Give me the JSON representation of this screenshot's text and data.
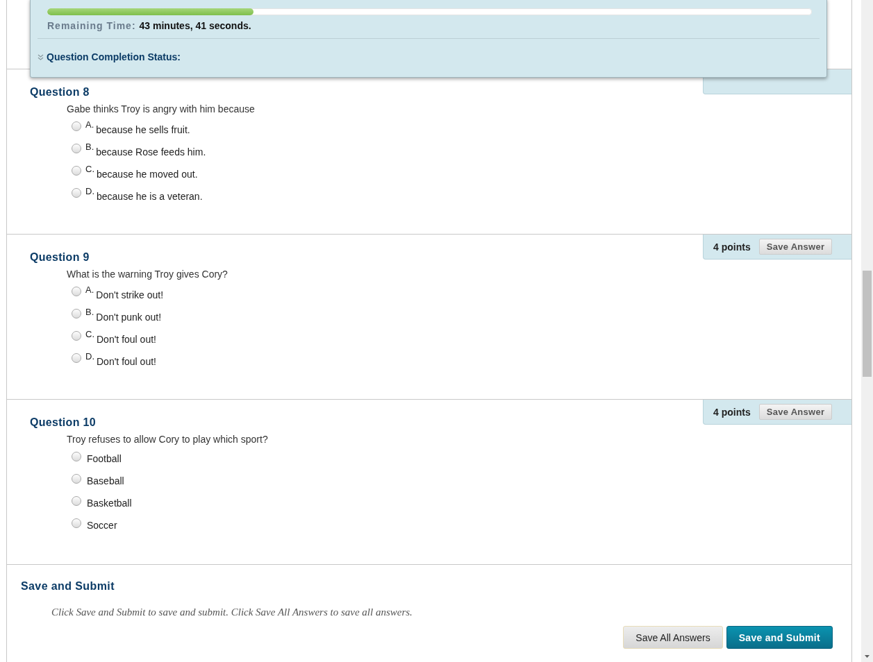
{
  "timer": {
    "level": 0.27,
    "label": "Remaining Time:",
    "value": "43 minutes, 41 seconds."
  },
  "completion_status": {
    "label": "Question Completion Status:",
    "expanded": false
  },
  "questions": [
    {
      "title": "Question 8",
      "prompt": "Gabe thinks Troy is angry with him because",
      "options": [
        {
          "letter": "A.",
          "text": "because he sells fruit.",
          "selected": false
        },
        {
          "letter": "B.",
          "text": "because Rose feeds him.",
          "selected": false
        },
        {
          "letter": "C.",
          "text": "because he moved out.",
          "selected": false
        },
        {
          "letter": "D.",
          "text": "because he is a veteran.",
          "selected": false
        }
      ]
    },
    {
      "title": "Question 9",
      "points": "4 points",
      "action": "Save Answer",
      "prompt": "What is the warning Troy gives Cory?",
      "options": [
        {
          "letter": "A.",
          "text": "Don't strike out!",
          "selected": false
        },
        {
          "letter": "B.",
          "text": "Don't punk out!",
          "selected": false
        },
        {
          "letter": "C.",
          "text": "Don't foul out!",
          "selected": false
        },
        {
          "letter": "D.",
          "text": "Don't foul out!",
          "selected": false
        }
      ]
    },
    {
      "title": "Question 10",
      "points": "4 points",
      "action": "Save Answer",
      "prompt": "Troy refuses to allow Cory to play which sport?",
      "options": [
        {
          "text": "Football",
          "selected": false
        },
        {
          "text": "Baseball",
          "selected": false
        },
        {
          "text": "Basketball",
          "selected": false
        },
        {
          "text": "Soccer",
          "selected": false
        }
      ]
    }
  ],
  "submit": {
    "title": "Save and Submit",
    "instructions": "Click Save and Submit to save and submit. Click Save All Answers to save all answers.",
    "buttons": [
      {
        "label": "Save All Answers",
        "kind": "secondary"
      },
      {
        "label": "Save and Submit",
        "kind": "primary"
      }
    ]
  }
}
